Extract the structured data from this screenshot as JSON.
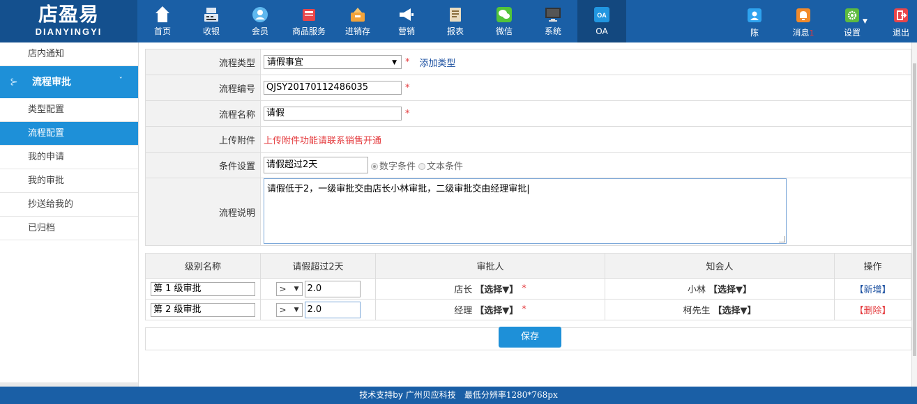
{
  "logo": {
    "cn": "店盈易",
    "en": "DIANYINGYI"
  },
  "nav": [
    {
      "label": "首页",
      "icon": "home-icon",
      "color": "#ffffff"
    },
    {
      "label": "收银",
      "icon": "cash-register-icon",
      "color": "#dfe8f2"
    },
    {
      "label": "会员",
      "icon": "member-icon",
      "color": "#5fb8ef"
    },
    {
      "label": "商品服务",
      "icon": "goods-icon",
      "color": "#e8454a"
    },
    {
      "label": "进销存",
      "icon": "inventory-icon",
      "color": "#f2a33a"
    },
    {
      "label": "营销",
      "icon": "megaphone-icon",
      "color": "#ffffff"
    },
    {
      "label": "报表",
      "icon": "report-icon",
      "color": "#e9dcc0"
    },
    {
      "label": "微信",
      "icon": "wechat-icon",
      "color": "#52c43a"
    },
    {
      "label": "系统",
      "icon": "monitor-icon",
      "color": "#333333"
    },
    {
      "label": "OA",
      "icon": "oa-icon",
      "color": "#2196e0",
      "active": true
    }
  ],
  "right_nav": {
    "user": {
      "label": "陈",
      "icon": "user-icon",
      "color": "#2ea3ef"
    },
    "messages": {
      "label": "消息",
      "count": "1",
      "icon": "bell-icon",
      "color": "#f18a2b"
    },
    "settings": {
      "label": "设置",
      "icon": "gear-icon",
      "color": "#5dbb3f"
    },
    "logout": {
      "label": "退出",
      "icon": "logout-icon",
      "color": "#e8454a"
    }
  },
  "sidebar": {
    "top_item": "店内通知",
    "section": "流程审批",
    "items": [
      "类型配置",
      "流程配置",
      "我的申请",
      "我的审批",
      "抄送给我的",
      "已归档"
    ],
    "selected_index": 1
  },
  "form": {
    "type_label": "流程类型",
    "type_value": "请假事宜",
    "add_type": "添加类型",
    "code_label": "流程编号",
    "code_value": "QJSY20170112486035",
    "name_label": "流程名称",
    "name_value": "请假",
    "attach_label": "上传附件",
    "attach_note": "上传附件功能请联系销售开通",
    "cond_label": "条件设置",
    "cond_value": "请假超过2天",
    "cond_options": [
      "数字条件",
      "文本条件"
    ],
    "desc_label": "流程说明",
    "desc_value": "请假低于2，一级审批交由店长小林审批，二级审批交由经理审批|",
    "required_mark": "*"
  },
  "table": {
    "headers": [
      "级别名称",
      "请假超过2天",
      "审批人",
      "知会人",
      "操作"
    ],
    "rows": [
      {
        "level": "第 1 级审批",
        "op": ">",
        "value": "2.0",
        "approver": "店长",
        "cc": "小林",
        "action": "【新增】",
        "action_type": "add"
      },
      {
        "level": "第 2 级审批",
        "op": ">",
        "value": "2.0",
        "approver": "经理",
        "cc": "柯先生",
        "action": "【删除】",
        "action_type": "delete"
      }
    ],
    "pick": "【选择▼】"
  },
  "save_label": "保存",
  "footer": {
    "support": "技术支持by 广州贝应科技",
    "resolution": "最低分辨率1280*768px"
  }
}
